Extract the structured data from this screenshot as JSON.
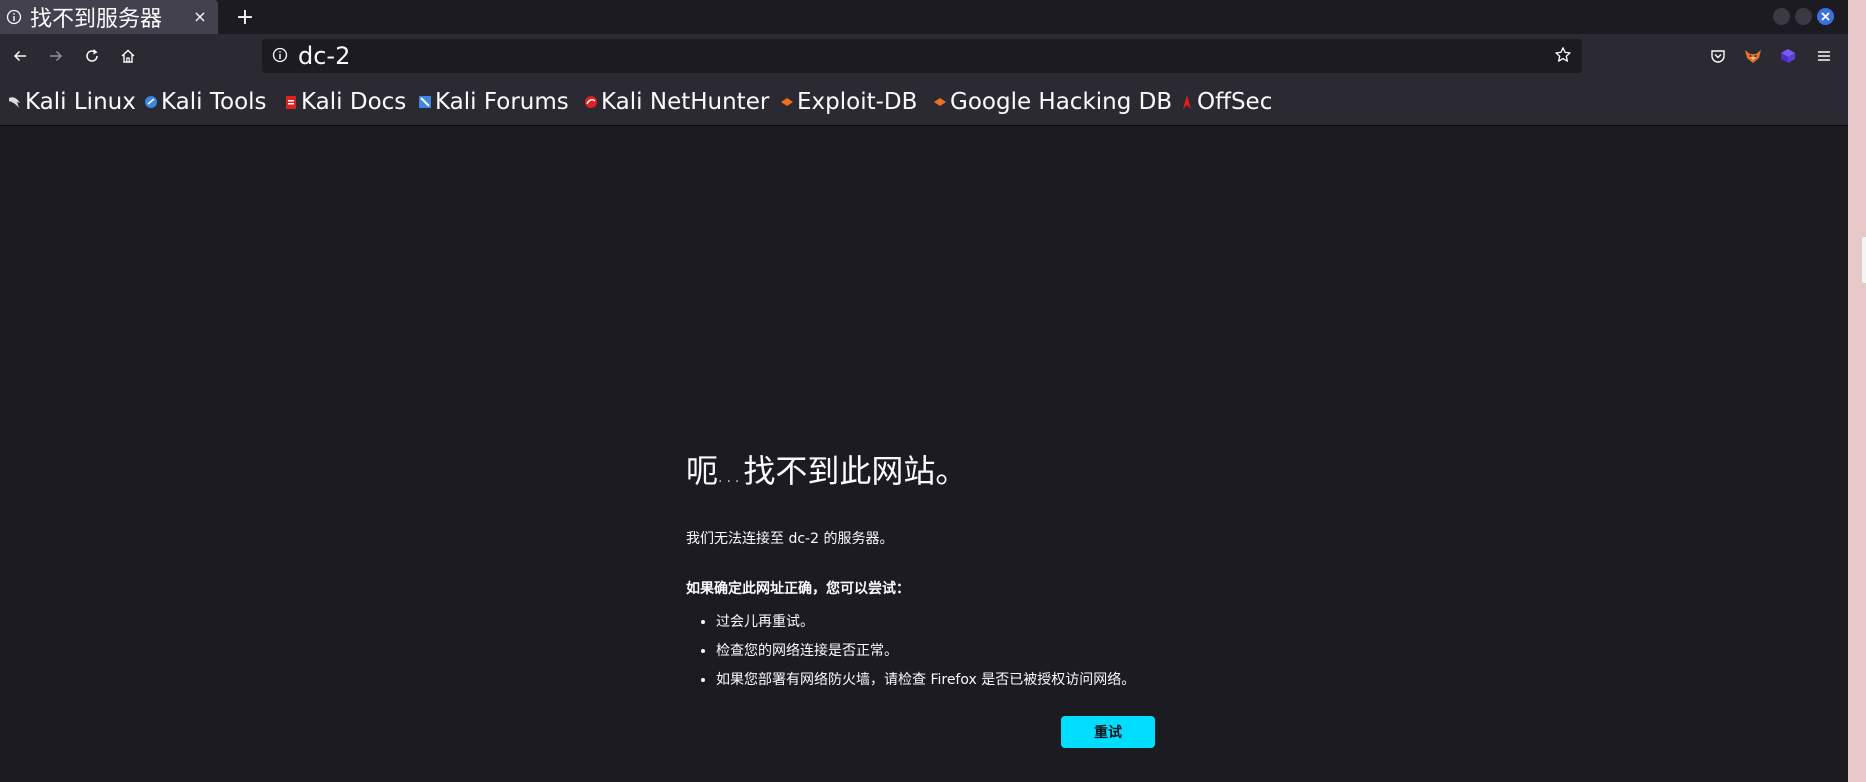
{
  "tab": {
    "title": "找不到服务器",
    "close": "×"
  },
  "newtab_label": "+",
  "urlbar": {
    "value": "dc-2"
  },
  "bookmarks": [
    {
      "label": "Kali Linux",
      "icon": "kali-dragon-icon",
      "color": "#dddddd"
    },
    {
      "label": "Kali Tools",
      "icon": "kali-tools-icon",
      "color": "#3a86e0"
    },
    {
      "label": "Kali Docs",
      "icon": "kali-docs-icon",
      "color": "#e02020"
    },
    {
      "label": "Kali Forums",
      "icon": "kali-forums-icon",
      "color": "#3a86e0"
    },
    {
      "label": "Kali NetHunter",
      "icon": "kali-nethunter-icon",
      "color": "#e02020"
    },
    {
      "label": "Exploit-DB",
      "icon": "exploit-db-icon",
      "color": "#f07020"
    },
    {
      "label": "Google Hacking DB",
      "icon": "ghdb-icon",
      "color": "#f07020"
    },
    {
      "label": "OffSec",
      "icon": "offsec-icon",
      "color": "#e02020"
    }
  ],
  "error": {
    "title_start": "呃",
    "title_dots": "...",
    "title_end": "找不到此网站。",
    "description": "我们无法连接至 dc-2 的服务器。",
    "suggestion_heading": "如果确定此网址正确，您可以尝试：",
    "suggestions": [
      "过会儿再重试。",
      "检查您的网络连接是否正常。",
      "如果您部署有网络防火墙，请检查 Firefox 是否已被授权访问网络。"
    ],
    "retry_label": "重试"
  },
  "colors": {
    "accent": "#00ddff",
    "background": "#1c1b22",
    "toolbar": "#2b2a33"
  }
}
